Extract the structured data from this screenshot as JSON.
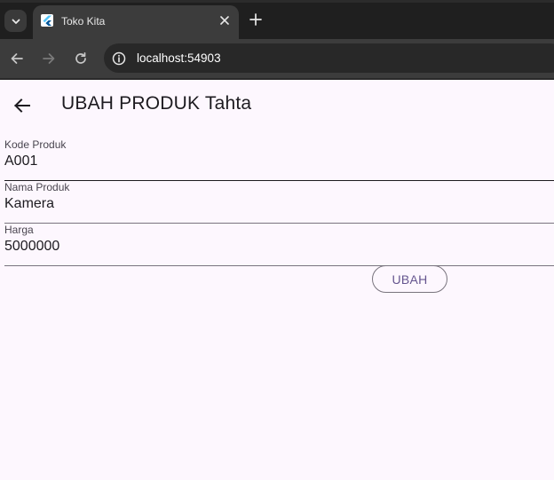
{
  "browser": {
    "tab_title": "Toko Kita",
    "url": "localhost:54903",
    "colors": {
      "tabbar": "#1f1f1f",
      "toolbar": "#3c3c3c",
      "favicon": "#54c5f8"
    }
  },
  "app": {
    "title": "UBAH PRODUK Tahta",
    "fields": [
      {
        "label": "Kode Produk",
        "value": "A001"
      },
      {
        "label": "Nama Produk",
        "value": "Kamera"
      },
      {
        "label": "Harga",
        "value": "5000000"
      }
    ],
    "submit_label": "UBAH",
    "colors": {
      "background": "#fdf7fe",
      "primary": "#65558f",
      "outline": "#79747e"
    }
  }
}
